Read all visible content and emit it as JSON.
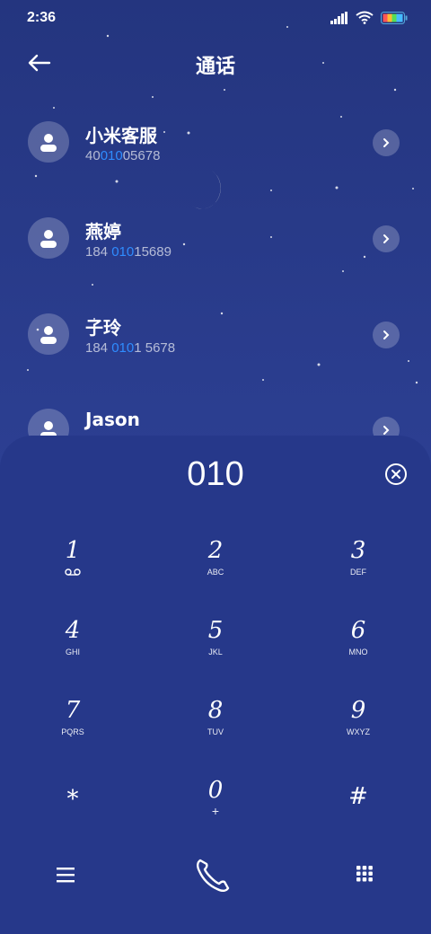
{
  "status": {
    "time": "2:36"
  },
  "header": {
    "title": "通话"
  },
  "contacts": [
    {
      "name": "小米客服",
      "num_pre": "40",
      "num_hl": "010",
      "num_post": "05678"
    },
    {
      "name": "燕婷",
      "num_pre": "184 ",
      "num_hl": "010",
      "num_post": "15689"
    },
    {
      "name": "子玲",
      "num_pre": "184 ",
      "num_hl": "010",
      "num_post": "1 5678"
    },
    {
      "name": "Jason",
      "num_pre": "",
      "num_hl": "",
      "num_post": ""
    }
  ],
  "dialer": {
    "entered": "010",
    "keys": [
      {
        "digit": "1",
        "letters": ""
      },
      {
        "digit": "2",
        "letters": "ABC"
      },
      {
        "digit": "3",
        "letters": "DEF"
      },
      {
        "digit": "4",
        "letters": "GHI"
      },
      {
        "digit": "5",
        "letters": "JKL"
      },
      {
        "digit": "6",
        "letters": "MNO"
      },
      {
        "digit": "7",
        "letters": "PQRS"
      },
      {
        "digit": "8",
        "letters": "TUV"
      },
      {
        "digit": "9",
        "letters": "WXYZ"
      },
      {
        "digit": "*",
        "letters": ""
      },
      {
        "digit": "0",
        "letters": "+"
      },
      {
        "digit": "#",
        "letters": ""
      }
    ]
  },
  "icons": {
    "back": "back-arrow-icon",
    "contact": "person-icon",
    "chevron": "chevron-right-icon",
    "clear": "clear-icon",
    "voicemail": "voicemail-icon",
    "menu": "menu-icon",
    "call": "phone-icon",
    "keypad": "keypad-icon"
  },
  "colors": {
    "background": "#2c3f92",
    "panel": "#26388a",
    "highlight": "#2f8cff"
  }
}
